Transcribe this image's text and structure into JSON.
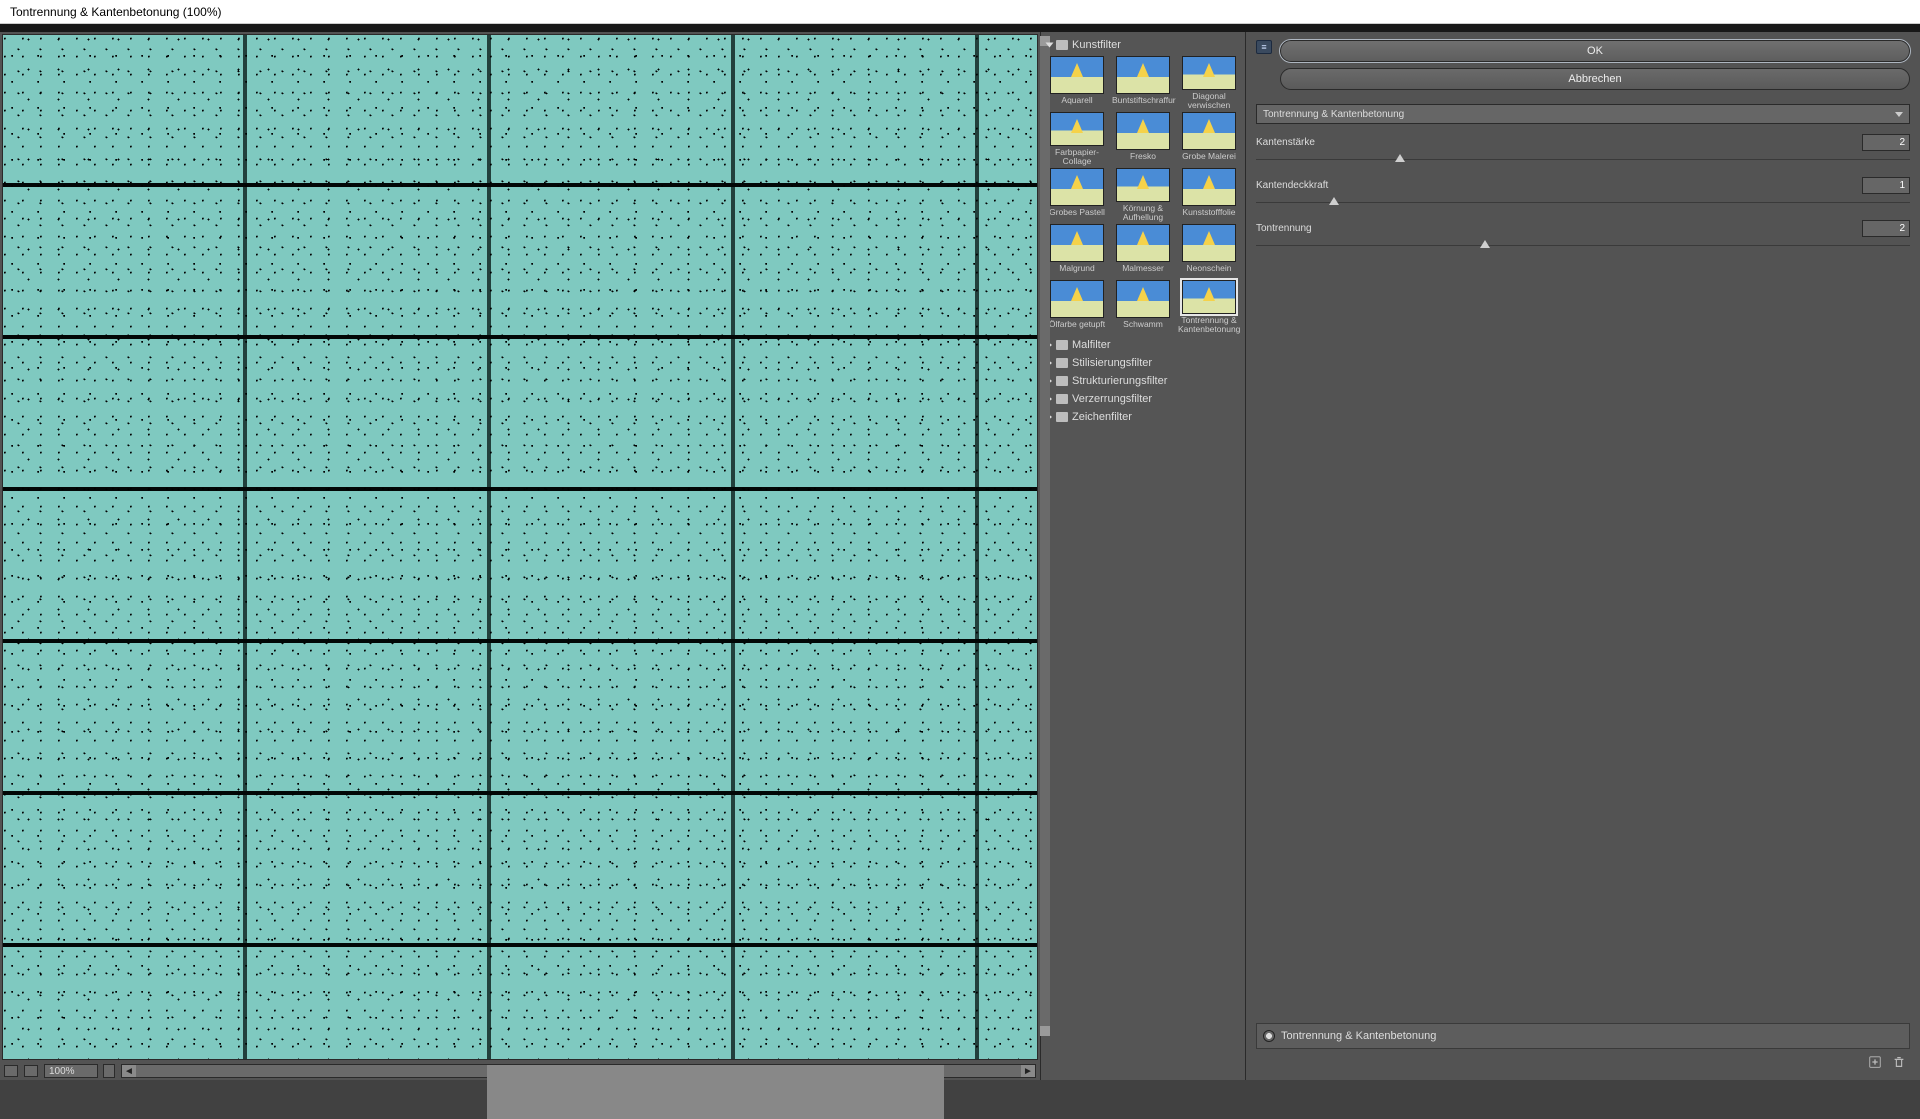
{
  "title": "Tontrennung & Kantenbetonung (100%)",
  "zoom": "100%",
  "buttons": {
    "ok": "OK",
    "cancel": "Abbrechen"
  },
  "filter_dropdown": "Tontrennung & Kantenbetonung",
  "sliders": [
    {
      "label": "Kantenstärke",
      "value": "2",
      "pos": 22
    },
    {
      "label": "Kantendeckkraft",
      "value": "1",
      "pos": 12
    },
    {
      "label": "Tontrennung",
      "value": "2",
      "pos": 35
    }
  ],
  "categories": [
    {
      "label": "Kunstfilter",
      "open": true,
      "thumbs": [
        "Aquarell",
        "Buntstiftschraffur",
        "Diagonal verwischen",
        "Farbpapier-Collage",
        "Fresko",
        "Grobe Malerei",
        "Grobes Pastell",
        "Körnung & Aufhellung",
        "Kunststofffolie",
        "Malgrund",
        "Malmesser",
        "Neonschein",
        "Ölfarbe getupft",
        "Schwamm",
        "Tontrennung & Kantenbetonung"
      ],
      "selected": 14
    },
    {
      "label": "Malfilter"
    },
    {
      "label": "Stilisierungsfilter"
    },
    {
      "label": "Strukturierungsfilter"
    },
    {
      "label": "Verzerrungsfilter"
    },
    {
      "label": "Zeichenfilter"
    }
  ],
  "effect_layer": "Tontrennung & Kantenbetonung",
  "mini_icon": "≡"
}
